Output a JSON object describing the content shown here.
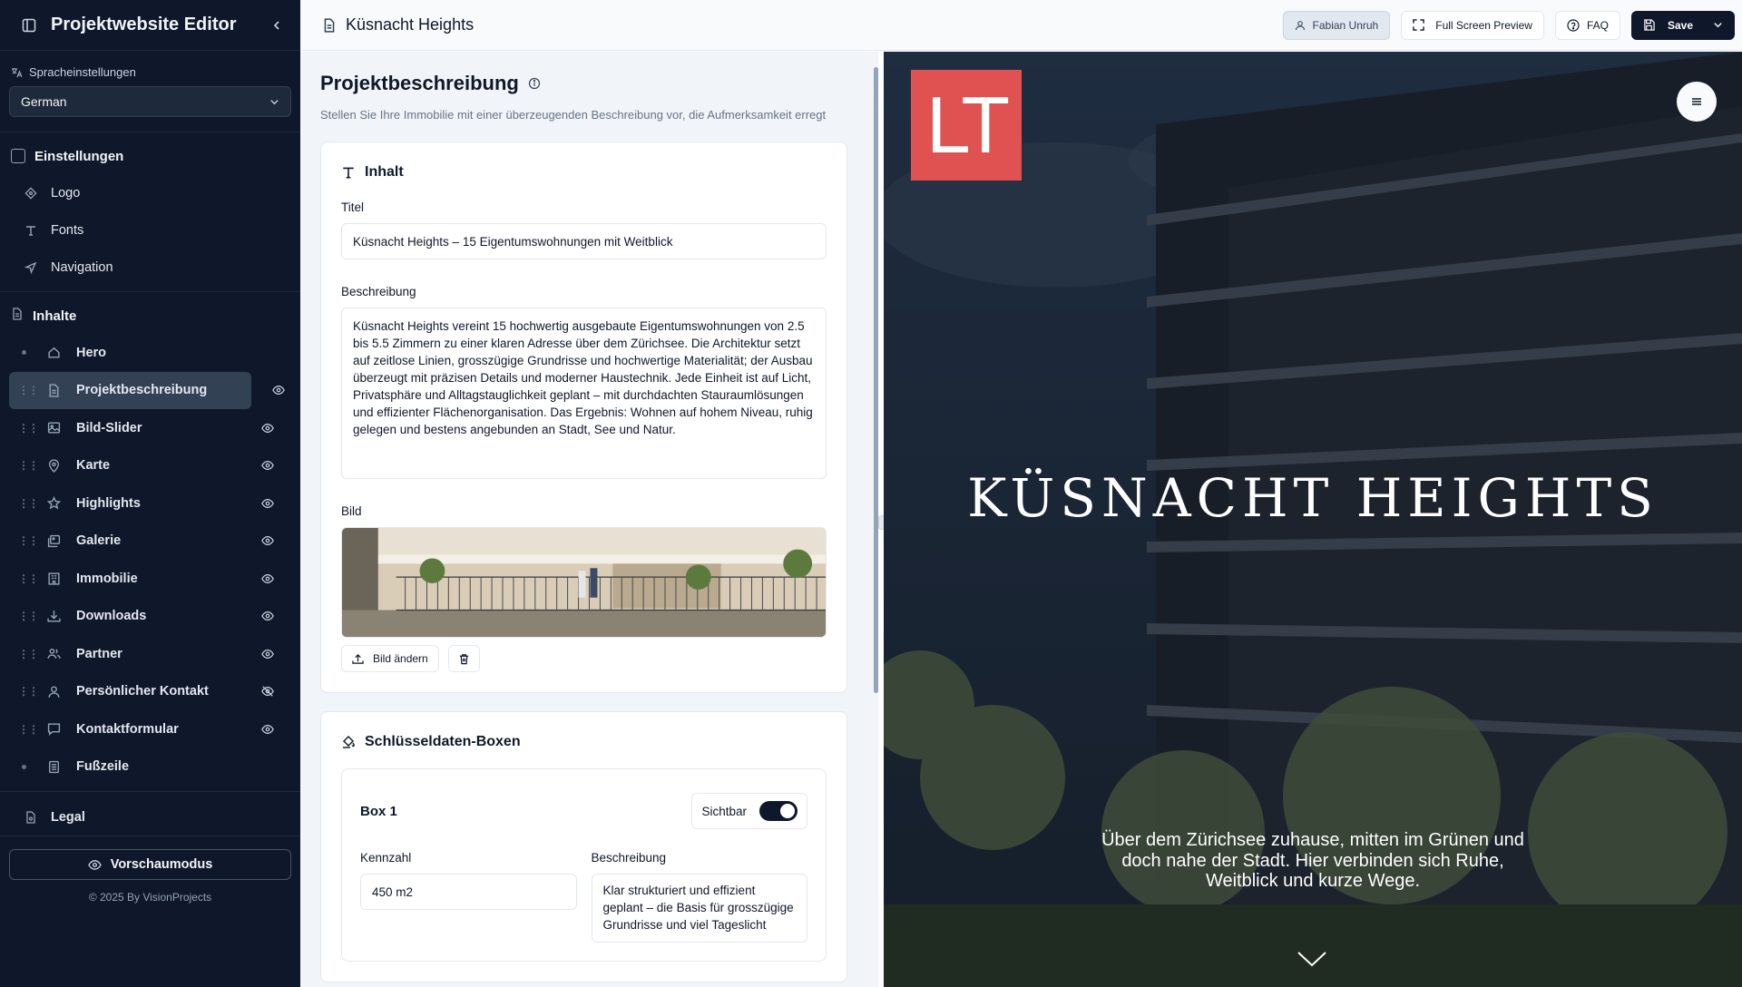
{
  "app": {
    "title": "Projektwebsite Editor"
  },
  "language": {
    "label": "Spracheinstellungen",
    "selected": "German"
  },
  "settings": {
    "label": "Einstellungen",
    "items": [
      {
        "label": "Logo",
        "icon": "logo-icon"
      },
      {
        "label": "Fonts",
        "icon": "type-icon"
      },
      {
        "label": "Navigation",
        "icon": "navigation-icon"
      }
    ]
  },
  "contents": {
    "label": "Inhalte",
    "items": [
      {
        "label": "Hero",
        "icon": "home-icon",
        "handle": "dot",
        "visible": null
      },
      {
        "label": "Projektbeschreibung",
        "icon": "file-icon",
        "handle": "drag",
        "visible": true,
        "active": true
      },
      {
        "label": "Bild-Slider",
        "icon": "image-icon",
        "handle": "drag",
        "visible": true
      },
      {
        "label": "Karte",
        "icon": "map-pin-icon",
        "handle": "drag",
        "visible": true
      },
      {
        "label": "Highlights",
        "icon": "star-icon",
        "handle": "drag",
        "visible": true
      },
      {
        "label": "Galerie",
        "icon": "gallery-icon",
        "handle": "drag",
        "visible": true
      },
      {
        "label": "Immobilie",
        "icon": "building-icon",
        "handle": "drag",
        "visible": true
      },
      {
        "label": "Downloads",
        "icon": "download-icon",
        "handle": "drag",
        "visible": true
      },
      {
        "label": "Partner",
        "icon": "users-icon",
        "handle": "drag",
        "visible": true
      },
      {
        "label": "Persönlicher Kontakt",
        "icon": "user-icon",
        "handle": "drag",
        "visible": false
      },
      {
        "label": "Kontaktformular",
        "icon": "message-icon",
        "handle": "drag",
        "visible": true
      },
      {
        "label": "Fußzeile",
        "icon": "footer-icon",
        "handle": "dot",
        "visible": null
      }
    ]
  },
  "legal": {
    "label": "Legal"
  },
  "footer": {
    "preview_mode": "Vorschaumodus",
    "copyright": "© 2025 By VisionProjects"
  },
  "topbar": {
    "page_title": "Küsnacht Heights",
    "user": "Fabian Unruh",
    "full_screen": "Full Screen Preview",
    "faq": "FAQ",
    "save": "Save"
  },
  "editor": {
    "heading": "Projektbeschreibung",
    "subheading": "Stellen Sie Ihre Immobilie mit einer überzeugenden Beschreibung vor, die Aufmerksamkeit erregt",
    "content_card": {
      "title": "Inhalt",
      "title_label": "Titel",
      "title_value": "Küsnacht Heights – 15 Eigentumswohnungen mit Weitblick",
      "desc_label": "Beschreibung",
      "desc_value": "Küsnacht Heights vereint 15 hochwertig ausgebaute Eigentumswohnungen von 2.5 bis 5.5 Zimmern zu einer klaren Adresse über dem Zürichsee. Die Architektur setzt auf zeitlose Linien, grosszügige Grundrisse und hochwertige Materialität; der Ausbau überzeugt mit präzisen Details und moderner Haustechnik. Jede Einheit ist auf Licht, Privatsphäre und Alltagstauglichkeit geplant – mit durchdachten Stauraumlösungen und effizienter Flächenorganisation. Das Ergebnis: Wohnen auf hohem Niveau, ruhig gelegen und bestens angebunden an Stadt, See und Natur.",
      "image_label": "Bild",
      "change_image": "Bild ändern"
    },
    "key_boxes": {
      "title": "Schlüsseldaten-Boxen",
      "box": {
        "title": "Box 1",
        "visible_label": "Sichtbar",
        "kpi_label": "Kennzahl",
        "kpi_value": "450 m2",
        "desc_label": "Beschreibung",
        "desc_value": "Klar strukturiert und effizient geplant – die Basis für grosszügige Grundrisse und viel Tageslicht"
      }
    }
  },
  "preview": {
    "logo_text": "LT",
    "title": "KÜSNACHT HEIGHTS",
    "subtitle": "Über dem Zürichsee zuhause, mitten im Grünen und doch nahe der Stadt. Hier verbinden sich Ruhe, Weitblick und kurze Wege."
  },
  "colors": {
    "sidebar_bg": "#0f172a",
    "accent_dark": "#0f172a",
    "logo_red": "#e05252"
  }
}
